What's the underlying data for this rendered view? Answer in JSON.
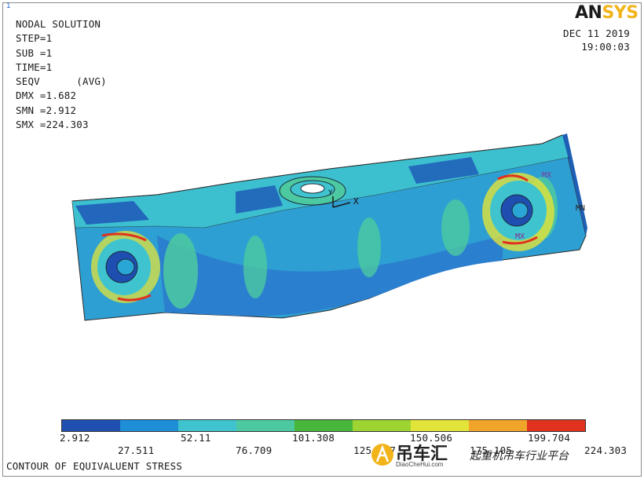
{
  "corner_index": "1",
  "info": {
    "title": "NODAL SOLUTION",
    "step": "STEP=1",
    "sub": "SUB =1",
    "time": "TIME=1",
    "seqv": "SEQV      (AVG)",
    "dmx": "DMX =1.682",
    "smn": "SMN =2.912",
    "smx": "SMX =224.303"
  },
  "logo": {
    "main": "AN",
    "accent": "SYS"
  },
  "date": "DEC 11 2019",
  "time_of_day": "19:00:03",
  "markers": {
    "axis_x": "X",
    "axis_y": "Y",
    "mx": "MX",
    "mn": "MN",
    "mx2": "MX"
  },
  "legend": {
    "colors": [
      "#1f4fb0",
      "#1e8fd6",
      "#3fc4cf",
      "#4cc9a0",
      "#48b63a",
      "#9ed431",
      "#e2e43a",
      "#f0a42a",
      "#e0321e"
    ],
    "labels": [
      "2.912",
      "27.511",
      "52.11",
      "76.709",
      "101.308",
      "125.907",
      "150.506",
      "175.105",
      "199.704",
      "224.303"
    ]
  },
  "footer": "CONTOUR OF EQUIVALUENT STRESS",
  "watermark": {
    "brand": "吊车汇",
    "url": "DiaoCheHui.com",
    "slogan": "起重机吊车行业平台"
  }
}
